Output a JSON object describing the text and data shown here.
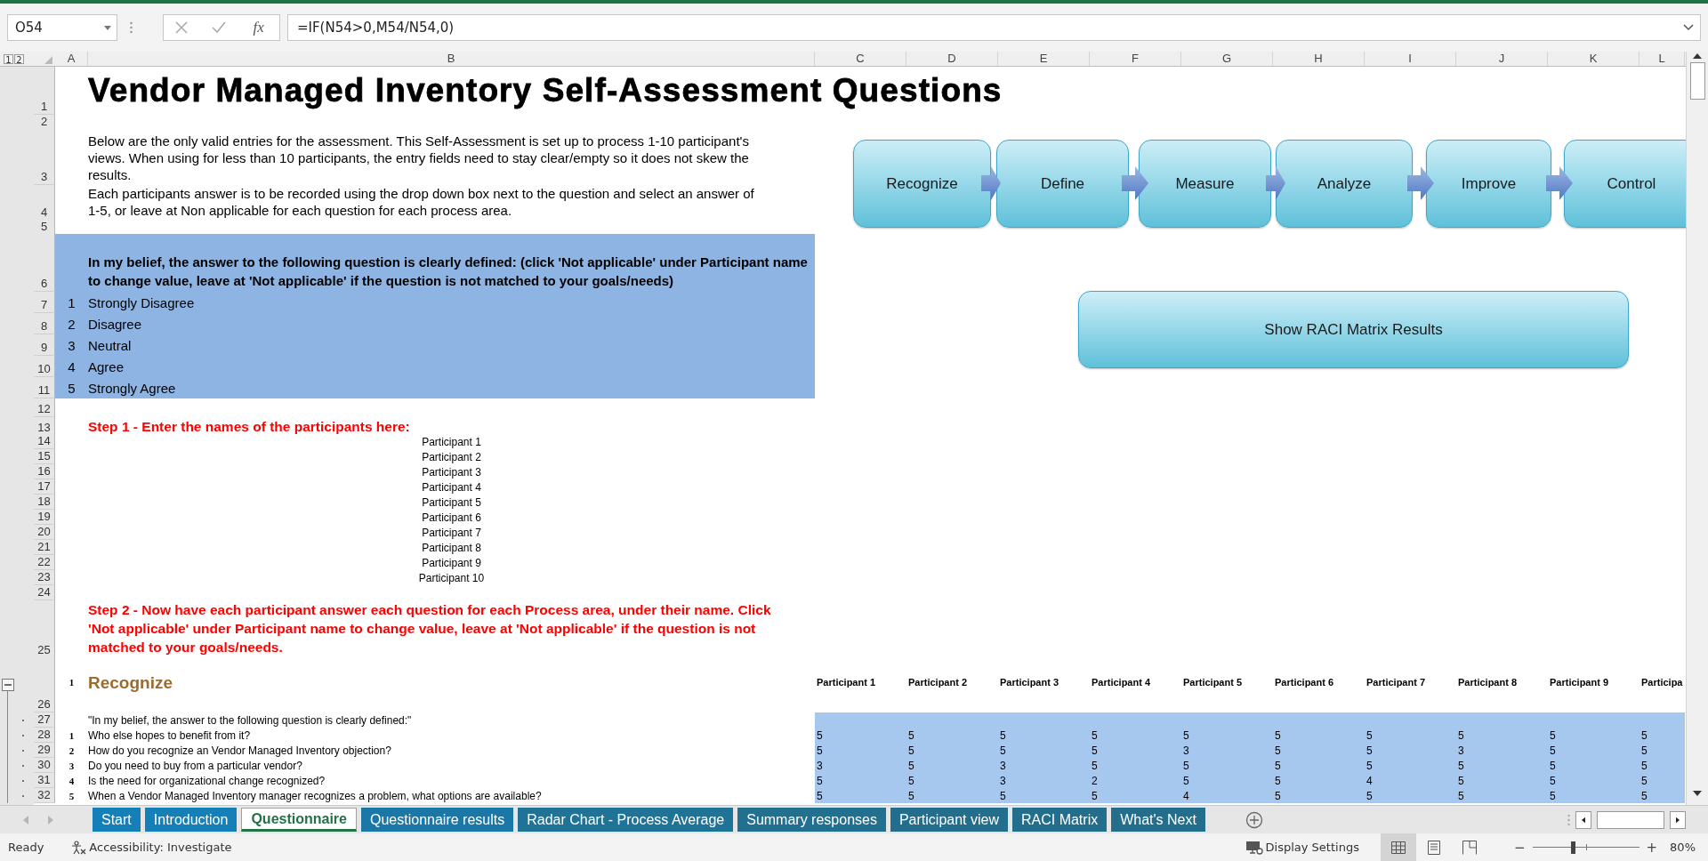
{
  "formula_bar": {
    "name_box": "O54",
    "insert_function": "fx",
    "formula": "=IF(N54>0,M54/N54,0)"
  },
  "sheet": {
    "outline_levels": [
      "1",
      "2"
    ],
    "columns": [
      "A",
      "B",
      "C",
      "D",
      "E",
      "F",
      "G",
      "H",
      "I",
      "J",
      "K",
      "L"
    ],
    "row_numbers": [
      "1",
      "2",
      "3",
      "4",
      "5",
      "6",
      "7",
      "8",
      "9",
      "10",
      "11",
      "12",
      "13",
      "14",
      "15",
      "16",
      "17",
      "18",
      "19",
      "20",
      "21",
      "22",
      "23",
      "24",
      "25",
      "26",
      "27",
      "28",
      "29",
      "30",
      "31",
      "32"
    ],
    "title": "Vendor Managed Inventory Self-Assessment Questions",
    "instructions": [
      "Below are the only valid entries for the assessment. This Self-Assessment is set up to process 1-10 participant's views. When using for less than 10 participants, the entry fields need to stay clear/empty so it does not skew the results.",
      "Each participants answer is to be recorded using the drop down box next to the question and select an answer of 1-5, or leave at Non applicable for each question for each process area."
    ],
    "scale_heading": "In my belief, the answer to the following question is clearly defined: (click 'Not applicable' under Participant name to change value, leave at 'Not applicable' if the question is not matched to your goals/needs)",
    "scale": [
      {
        "value": "1",
        "label": "Strongly Disagree"
      },
      {
        "value": "2",
        "label": "Disagree"
      },
      {
        "value": "3",
        "label": "Neutral"
      },
      {
        "value": "4",
        "label": "Agree"
      },
      {
        "value": "5",
        "label": "Strongly Agree"
      }
    ],
    "step1": "Step 1 - Enter the names of the participants here:",
    "participants": [
      "Participant 1",
      "Participant 2",
      "Participant 3",
      "Participant 4",
      "Participant 5",
      "Participant 6",
      "Participant 7",
      "Participant 8",
      "Participant 9",
      "Participant 10"
    ],
    "step2": "Step 2 - Now have each participant answer each question for each Process area, under their name. Click 'Not applicable' under Participant name to change value, leave at 'Not applicable' if the question is not matched to your goals/needs.",
    "section": {
      "number": "1",
      "title": "Recognize",
      "expanded": true
    },
    "participant_headers": [
      "Participant 1",
      "Participant 2",
      "Participant 3",
      "Participant 4",
      "Participant 5",
      "Participant 6",
      "Participant 7",
      "Participant 8",
      "Participant 9",
      "Participa"
    ],
    "question_intro": "\"In my belief, the answer to the following question is clearly defined:\"",
    "questions": [
      {
        "number": "1",
        "text": "Who else hopes to benefit from it?",
        "answers": [
          "5",
          "5",
          "5",
          "5",
          "5",
          "5",
          "5",
          "5",
          "5",
          "5"
        ]
      },
      {
        "number": "2",
        "text": "How do you recognize an Vendor Managed Inventory objection?",
        "answers": [
          "5",
          "5",
          "5",
          "5",
          "3",
          "5",
          "5",
          "3",
          "5",
          "5"
        ]
      },
      {
        "number": "3",
        "text": "Do you need to buy from a particular vendor?",
        "answers": [
          "3",
          "5",
          "3",
          "5",
          "5",
          "5",
          "5",
          "5",
          "5",
          "5"
        ]
      },
      {
        "number": "4",
        "text": "Is the need for organizational change recognized?",
        "answers": [
          "5",
          "5",
          "3",
          "2",
          "5",
          "5",
          "4",
          "5",
          "5",
          "5"
        ]
      },
      {
        "number": "5",
        "text": "When a Vendor Managed Inventory manager recognizes a problem, what options are available?",
        "answers": [
          "5",
          "5",
          "5",
          "5",
          "4",
          "5",
          "5",
          "5",
          "5",
          "5"
        ]
      }
    ],
    "process_steps": [
      "Recognize",
      "Define",
      "Measure",
      "Analyze",
      "Improve",
      "Control"
    ],
    "raci_button": "Show RACI Matrix Results"
  },
  "tabs": [
    {
      "label": "Start",
      "selected": false,
      "color": "#1580b8"
    },
    {
      "label": "Introduction",
      "selected": false,
      "color": "#1580b8"
    },
    {
      "label": "Questionnaire",
      "selected": true,
      "color": "#217346"
    },
    {
      "label": "Questionnaire results",
      "selected": false,
      "color": "#1b78a6"
    },
    {
      "label": "Radar Chart - Process Average",
      "selected": false,
      "color": "#1f7397"
    },
    {
      "label": "Summary responses",
      "selected": false,
      "color": "#22708f"
    },
    {
      "label": "Participant view",
      "selected": false,
      "color": "#236e8c"
    },
    {
      "label": "RACI Matrix",
      "selected": false,
      "color": "#236e8c"
    },
    {
      "label": "What's Next",
      "selected": false,
      "color": "#236e8c"
    }
  ],
  "status_bar": {
    "ready": "Ready",
    "accessibility": "Accessibility: Investigate",
    "display_settings": "Display Settings",
    "views": [
      {
        "kind": "normal",
        "selected": true
      },
      {
        "kind": "page_layout",
        "selected": false
      },
      {
        "kind": "page_break",
        "selected": false
      }
    ],
    "zoom_out": "−",
    "zoom_in": "+",
    "zoom": {
      "level": 0.38
    },
    "zoom_text": "80%"
  }
}
